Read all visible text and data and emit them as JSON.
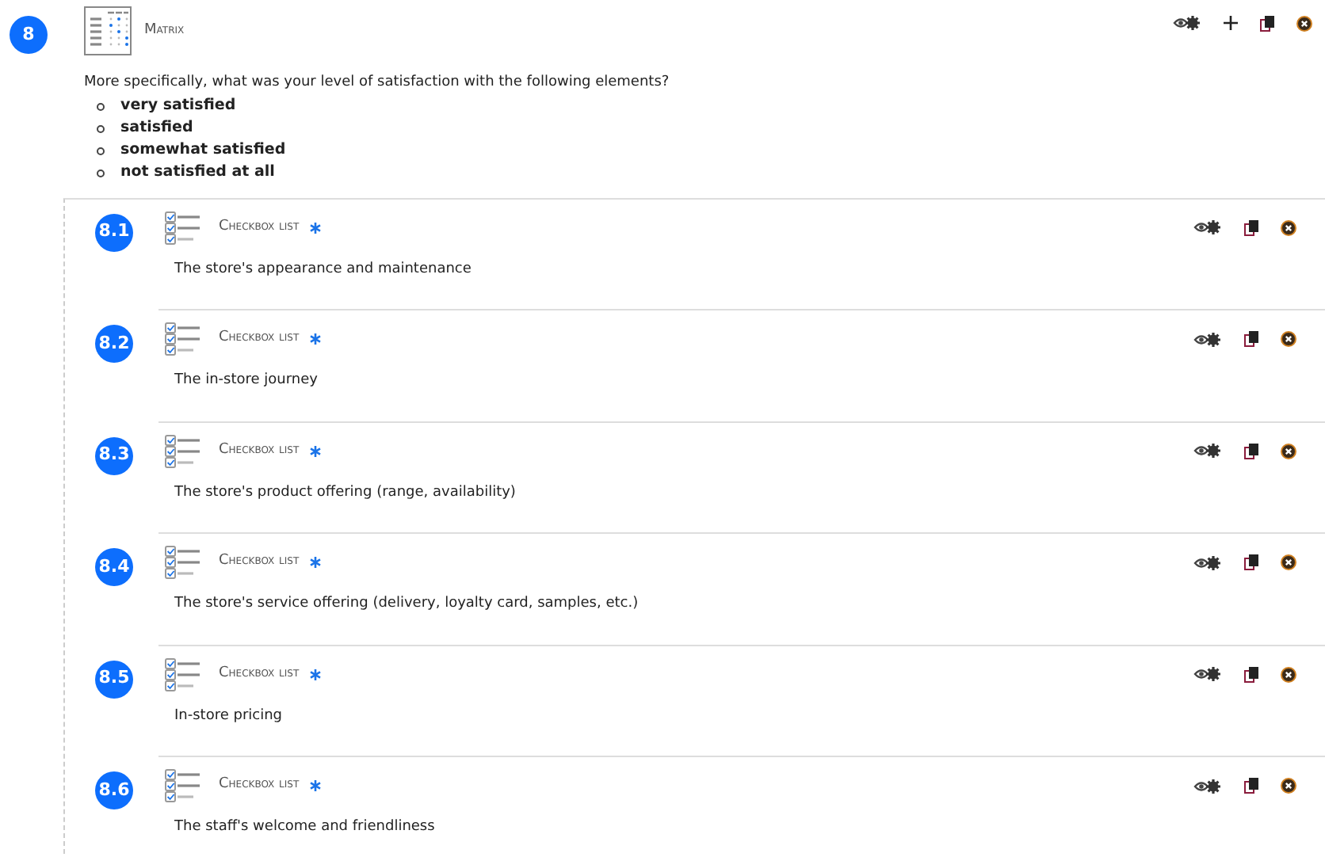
{
  "question": {
    "number": "8",
    "type": "Matrix",
    "text": "More specifically, what was your level of satisfaction with the following elements?",
    "options": [
      "very satisfied",
      "satisfied",
      "somewhat satisfied",
      "not satisfied at all"
    ],
    "subquestions": [
      {
        "number": "8.1",
        "type": "Checkbox list",
        "required": true,
        "text": "The store's appearance and maintenance"
      },
      {
        "number": "8.2",
        "type": "Checkbox list",
        "required": true,
        "text": "The in-store journey"
      },
      {
        "number": "8.3",
        "type": "Checkbox list",
        "required": true,
        "text": "The store's product offering (range, availability)"
      },
      {
        "number": "8.4",
        "type": "Checkbox list",
        "required": true,
        "text": "The store's service offering (delivery, loyalty card, samples, etc.)"
      },
      {
        "number": "8.5",
        "type": "Checkbox list",
        "required": true,
        "text": "In-store pricing"
      },
      {
        "number": "8.6",
        "type": "Checkbox list",
        "required": true,
        "text": "The staff's welcome and friendliness"
      }
    ]
  }
}
